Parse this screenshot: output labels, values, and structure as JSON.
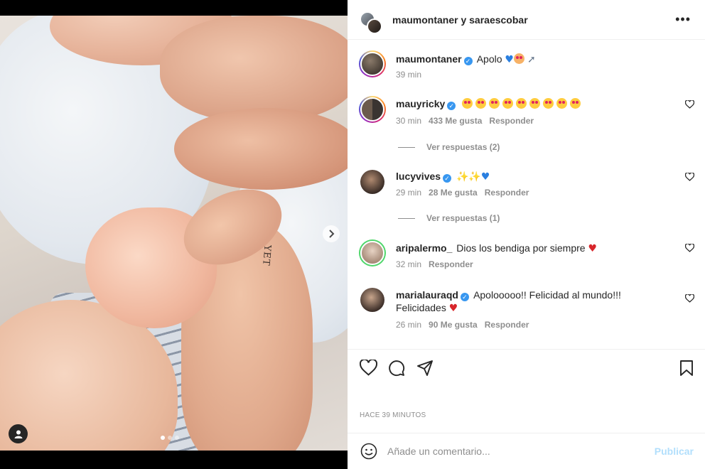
{
  "header": {
    "names": "maumontaner y saraescobar",
    "more_label": "•••"
  },
  "caption": {
    "user": "maumontaner",
    "text": "Apolo",
    "time": "39 min",
    "emojis": [
      "blue-heart",
      "baby-face",
      "rocket"
    ]
  },
  "comments": [
    {
      "user": "mauyricky",
      "text": "",
      "emoji_count": 9,
      "emoji": "heart-eyes-face",
      "time": "30 min",
      "likes": "433 Me gusta",
      "reply": "Responder",
      "view_replies": "Ver respuestas (2)"
    },
    {
      "user": "lucyvives",
      "text": "",
      "emojis": [
        "sparkles",
        "sparkles",
        "blue-heart"
      ],
      "time": "29 min",
      "likes": "28 Me gusta",
      "reply": "Responder",
      "view_replies": "Ver respuestas (1)"
    },
    {
      "user": "aripalermo_",
      "text": "Dios los bendiga por siempre",
      "emojis": [
        "red-heart"
      ],
      "time": "32 min",
      "reply": "Responder"
    },
    {
      "user": "marialauraqd",
      "text": "Apolooooo!! Felicidad al mundo!!!",
      "text2": "Felicidades",
      "emojis": [
        "red-heart"
      ],
      "time": "26 min",
      "likes": "90 Me gusta",
      "reply": "Responder"
    }
  ],
  "photo": {
    "tattoo_text": "YET",
    "carousel_total": 3,
    "carousel_active": 1
  },
  "footer": {
    "time_ago": "HACE 39 MINUTOS",
    "comment_placeholder": "Añade un comentario...",
    "publish_label": "Publicar"
  },
  "colors": {
    "verified": "#3897f0",
    "muted": "#8e8e8e",
    "publish_disabled": "#b2dffc"
  }
}
